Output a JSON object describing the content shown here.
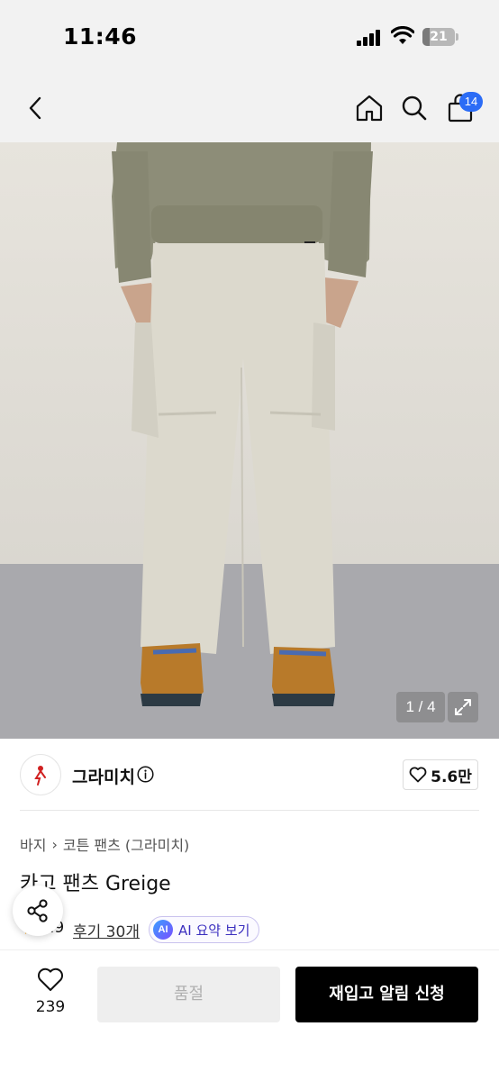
{
  "status_bar": {
    "time": "11:46",
    "battery": "21",
    "battery_level": 0.21
  },
  "nav": {
    "cart_badge": "14"
  },
  "gallery": {
    "counter": "1 / 4"
  },
  "brand": {
    "name": "그라미치",
    "likes": "5.6만"
  },
  "breadcrumb": {
    "items": [
      "바지",
      "코튼 팬츠 (그라미치)"
    ]
  },
  "product": {
    "name": "카고 팬츠 Greige"
  },
  "rating": {
    "value": ".9",
    "reviews": "후기 30개"
  },
  "ai": {
    "badge": "AI",
    "label": "AI 요약 보기"
  },
  "bottom": {
    "wish_count": "239",
    "soldout_label": "품절",
    "restock_label": "재입고 알림 신청"
  },
  "colors": {
    "accent": "#2b6cf6",
    "primary_button": "#000000",
    "ai_text": "#3b2fbf"
  },
  "icons": [
    "back-icon",
    "home-icon",
    "search-icon",
    "cart-icon",
    "expand-icon",
    "info-icon",
    "heart-icon",
    "share-icon",
    "star-icon"
  ]
}
